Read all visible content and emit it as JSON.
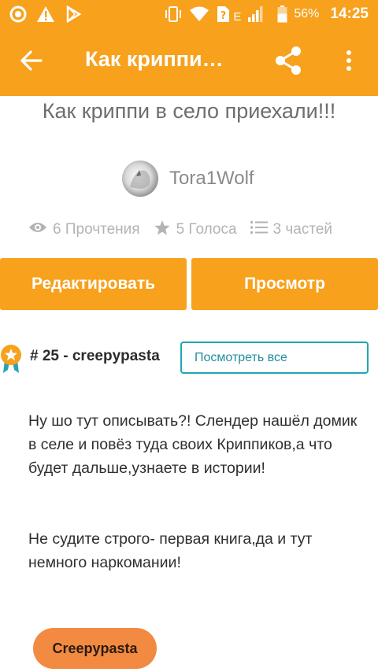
{
  "status_bar": {
    "network": "E",
    "battery": "56%",
    "time": "14:25"
  },
  "toolbar": {
    "title": "Как криппи…",
    "icons": [
      "back-arrow-icon",
      "share-icon",
      "more-vert-icon"
    ]
  },
  "story": {
    "title": "Как криппи в село приехали!!!",
    "author": "Tora1Wolf",
    "stats": {
      "reads": "6 Прочтения",
      "votes": "5 Голоса",
      "parts": "3 частей"
    }
  },
  "actions": {
    "edit_label": "Редактировать",
    "view_label": "Просмотр"
  },
  "ranking": {
    "text": "# 25 - creepypasta",
    "see_all_label": "Посмотреть все"
  },
  "description": [
    "Ну шо тут описывать?! Слендер нашёл домик в селе и повёз туда своих Криппиков,а что будет дальше,узнаете в истории!",
    "Не судите строго- первая книга,да и тут немного наркомании!"
  ],
  "tags": [
    "Creepypasta"
  ],
  "colors": {
    "accent": "#f7a11d",
    "teal": "#20a6b5",
    "tag": "#f28a42"
  }
}
